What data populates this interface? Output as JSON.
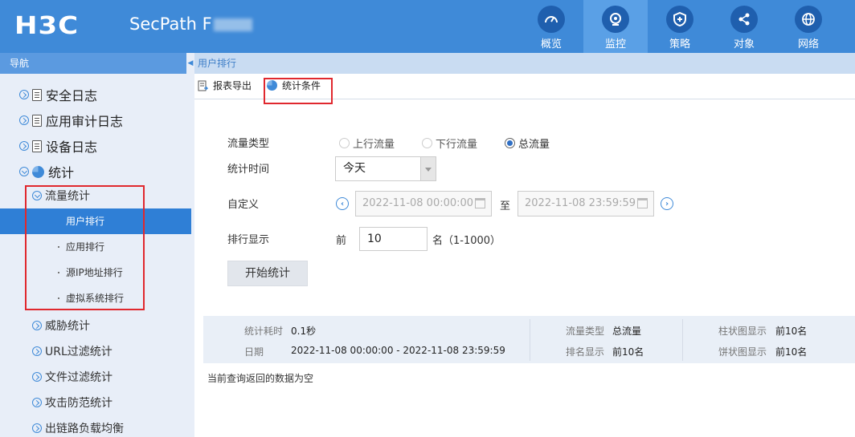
{
  "header": {
    "logo": "H3C",
    "product": "SecPath F",
    "nav": [
      {
        "label": "概览",
        "icon": "dashboard-icon"
      },
      {
        "label": "监控",
        "icon": "monitor-eye-icon",
        "active": true
      },
      {
        "label": "策略",
        "icon": "shield-plus-icon"
      },
      {
        "label": "对象",
        "icon": "share-nodes-icon"
      },
      {
        "label": "网络",
        "icon": "globe-icon"
      }
    ]
  },
  "sidebar": {
    "title": "导航",
    "groups": [
      {
        "label": "安全日志"
      },
      {
        "label": "应用审计日志"
      },
      {
        "label": "设备日志"
      },
      {
        "label": "统计"
      }
    ],
    "sub_flow": "流量统计",
    "leaves": [
      "用户排行",
      "应用排行",
      "源IP地址排行",
      "虚拟系统排行"
    ],
    "subs": [
      "威胁统计",
      "URL过滤统计",
      "文件过滤统计",
      "攻击防范统计",
      "出链路负载均衡"
    ]
  },
  "main": {
    "page_title": "用户排行",
    "toolbar": {
      "export": "报表导出",
      "conditions": "统计条件"
    },
    "form": {
      "flow_type_label": "流量类型",
      "flow_options": [
        "上行流量",
        "下行流量",
        "总流量"
      ],
      "flow_selected": "总流量",
      "time_label": "统计时间",
      "time_value": "今天",
      "custom_label": "自定义",
      "start_date": "2022-11-08 00:00:00",
      "to": "至",
      "end_date": "2022-11-08 23:59:59",
      "rank_label": "排行显示",
      "rank_prefix": "前",
      "rank_value": "10",
      "rank_suffix": "名（1-1000）",
      "start_button": "开始统计"
    },
    "summary": {
      "cost_label": "统计耗时",
      "cost_value": "0.1秒",
      "date_label": "日期",
      "date_value": "2022-11-08 00:00:00 - 2022-11-08 23:59:59",
      "type_label": "流量类型",
      "type_value": "总流量",
      "rank_label": "排名显示",
      "rank_value": "前10名",
      "bar_label": "柱状图显示",
      "bar_value": "前10名",
      "pie_label": "饼状图显示",
      "pie_value": "前10名"
    },
    "empty_message": "当前查询返回的数据为空"
  },
  "colors": {
    "header": "#3f8ad8",
    "active_nav": "#2f7fd6",
    "highlight_box": "#e0282e"
  }
}
